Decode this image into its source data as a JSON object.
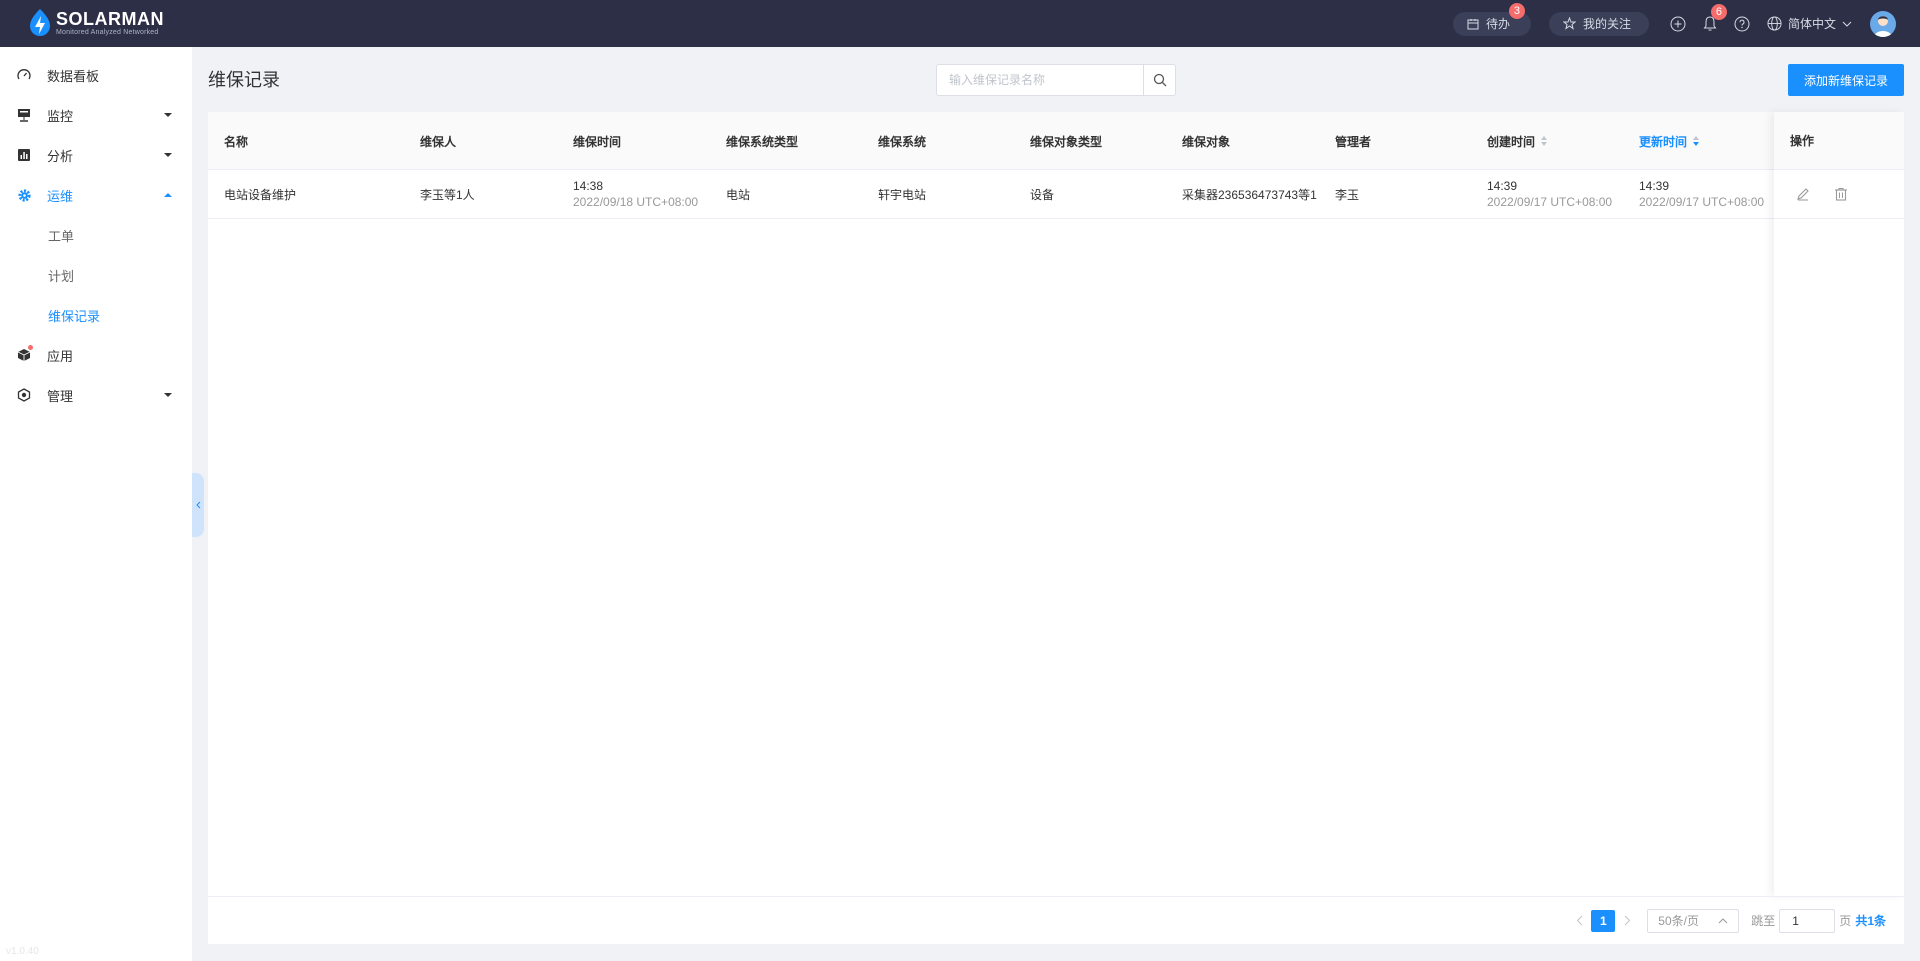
{
  "brand": {
    "title": "SOLARMAN",
    "subtitle": "Monitored Analyzed Networked"
  },
  "topbar": {
    "todo_label": "待办",
    "todo_count": "3",
    "favorites_label": "我的关注",
    "notification_count": "6",
    "language": "简体中文"
  },
  "sidebar": {
    "items": [
      {
        "label": "数据看板"
      },
      {
        "label": "监控"
      },
      {
        "label": "分析"
      },
      {
        "label": "运维"
      },
      {
        "label": "工单"
      },
      {
        "label": "计划"
      },
      {
        "label": "维保记录"
      },
      {
        "label": "应用"
      },
      {
        "label": "管理"
      }
    ],
    "version": "v1.0.40"
  },
  "page": {
    "title": "维保记录",
    "search_placeholder": "输入维保记录名称",
    "add_button": "添加新维保记录"
  },
  "table": {
    "columns": {
      "name": "名称",
      "maintainer": "维保人",
      "maint_time": "维保时间",
      "system_type": "维保系统类型",
      "system": "维保系统",
      "object_type": "维保对象类型",
      "object": "维保对象",
      "manager": "管理者",
      "created": "创建时间",
      "updated": "更新时间",
      "ops": "操作"
    },
    "rows": [
      {
        "name": "电站设备维护",
        "maintainer": "李玉等1人",
        "maint_time": "14:38",
        "maint_date": "2022/09/18 UTC+08:00",
        "system_type": "电站",
        "system": "轩宇电站",
        "object_type": "设备",
        "object": "采集器2365364737­43等1",
        "manager": "李玉",
        "created_time": "14:39",
        "created_date": "2022/09/17 UTC+08:00",
        "updated_time": "14:39",
        "updated_date": "2022/09/17 UTC+08:00"
      }
    ]
  },
  "pagination": {
    "current": "1",
    "page_size": "50条/页",
    "jump_label": "跳至",
    "jump_value": "1",
    "page_suffix": "页",
    "total": "共1条"
  },
  "colors": {
    "topbar": "#2c2f45",
    "accent": "#1a90ff",
    "badge": "#f56c6c"
  }
}
